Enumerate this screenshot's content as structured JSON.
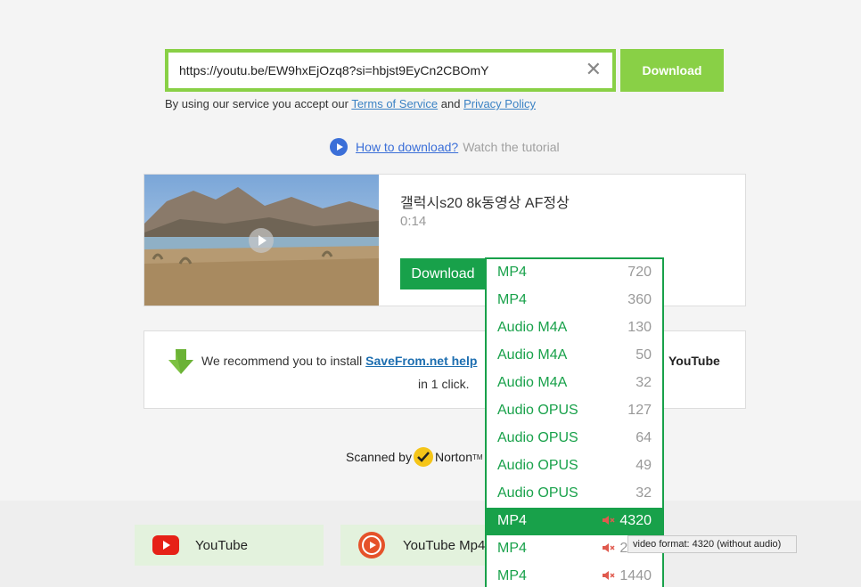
{
  "search": {
    "url_value": "https://youtu.be/EW9hxEjOzq8?si=hbjst9EyCn2CBOmY",
    "download_label": "Download"
  },
  "terms": {
    "prefix": "By using our service you accept our ",
    "tos_label": "Terms of Service",
    "and": " and ",
    "privacy_label": "Privacy Policy"
  },
  "howto": {
    "link_label": "How to download?",
    "suffix": "Watch the tutorial"
  },
  "video": {
    "title": "갤럭시s20 8k동영상 AF정상",
    "duration": "0:14",
    "download_label": "Download"
  },
  "formats": [
    {
      "name": "MP4",
      "quality": "720",
      "muted": false,
      "selected": false
    },
    {
      "name": "MP4",
      "quality": "360",
      "muted": false,
      "selected": false
    },
    {
      "name": "Audio M4A",
      "quality": "130",
      "muted": false,
      "selected": false
    },
    {
      "name": "Audio M4A",
      "quality": "50",
      "muted": false,
      "selected": false
    },
    {
      "name": "Audio M4A",
      "quality": "32",
      "muted": false,
      "selected": false
    },
    {
      "name": "Audio OPUS",
      "quality": "127",
      "muted": false,
      "selected": false
    },
    {
      "name": "Audio OPUS",
      "quality": "64",
      "muted": false,
      "selected": false
    },
    {
      "name": "Audio OPUS",
      "quality": "49",
      "muted": false,
      "selected": false
    },
    {
      "name": "Audio OPUS",
      "quality": "32",
      "muted": false,
      "selected": false
    },
    {
      "name": "MP4",
      "quality": "4320",
      "muted": true,
      "selected": true
    },
    {
      "name": "MP4",
      "quality": "2160",
      "muted": true,
      "selected": false
    },
    {
      "name": "MP4",
      "quality": "1440",
      "muted": true,
      "selected": false
    }
  ],
  "tooltip": "video format: 4320 (without audio)",
  "recommend": {
    "prefix": "We recommend you to install ",
    "link_label": "SaveFrom.net help",
    "youtube_label": "YouTube",
    "line2": "in 1 click."
  },
  "norton": {
    "prefix": "Scanned by",
    "brand": "Norton",
    "tm": "TM"
  },
  "tiles": {
    "youtube_label": "YouTube",
    "youtube_mp4_label": "YouTube Mp4"
  },
  "colors": {
    "accent_green": "#89d046",
    "download_green": "#18a14a",
    "link_blue": "#3b6fd8",
    "youtube_red": "#e62117"
  }
}
